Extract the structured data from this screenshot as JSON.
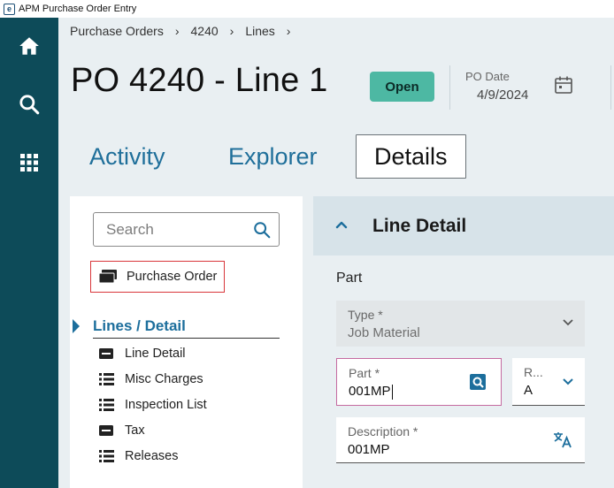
{
  "window": {
    "title": "APM Purchase Order Entry",
    "logo_letter": "e"
  },
  "rail": {
    "items": [
      "home-icon",
      "search-icon",
      "apps-grid-icon"
    ]
  },
  "breadcrumb": [
    {
      "label": "Purchase Orders"
    },
    {
      "label": "4240"
    },
    {
      "label": "Lines"
    }
  ],
  "breadcrumb_separator": "›",
  "header": {
    "title": "PO 4240 - Line 1",
    "status": "Open",
    "po_date_label": "PO Date",
    "po_date_value": "4/9/2024"
  },
  "tabs": [
    {
      "label": "Activity",
      "active": false
    },
    {
      "label": "Explorer",
      "active": false
    },
    {
      "label": "Details",
      "active": true
    }
  ],
  "sidebar": {
    "search_placeholder": "Search",
    "purchase_order_label": "Purchase Order",
    "section_title": "Lines / Detail",
    "items": [
      {
        "label": "Line Detail",
        "icon": "card-icon"
      },
      {
        "label": "Misc Charges",
        "icon": "list-icon"
      },
      {
        "label": "Inspection List",
        "icon": "list-icon"
      },
      {
        "label": "Tax",
        "icon": "card-icon"
      },
      {
        "label": "Releases",
        "icon": "list-icon"
      }
    ]
  },
  "detail": {
    "title": "Line Detail",
    "section": "Part",
    "type_label": "Type *",
    "type_value": "Job Material",
    "part_label": "Part *",
    "part_value": "001MP",
    "rev_label": "R...",
    "rev_value": "A",
    "description_label": "Description *",
    "description_value": "001MP"
  },
  "colors": {
    "rail": "#0d4b59",
    "accent": "#1c6e9c",
    "status_badge": "#4db8a3",
    "focus_border": "#c56aa0",
    "highlight_border": "#d9363a"
  }
}
